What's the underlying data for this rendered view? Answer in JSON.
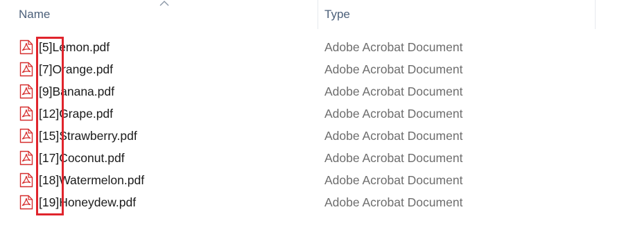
{
  "header": {
    "name_label": "Name",
    "type_label": "Type",
    "sort": "ascending"
  },
  "files": [
    {
      "name": "[5]Lemon.pdf",
      "type": "Adobe Acrobat Document",
      "icon": "pdf-file-icon"
    },
    {
      "name": "[7]Orange.pdf",
      "type": "Adobe Acrobat Document",
      "icon": "pdf-file-icon"
    },
    {
      "name": "[9]Banana.pdf",
      "type": "Adobe Acrobat Document",
      "icon": "pdf-file-icon"
    },
    {
      "name": "[12]Grape.pdf",
      "type": "Adobe Acrobat Document",
      "icon": "pdf-file-icon"
    },
    {
      "name": "[15]Strawberry.pdf",
      "type": "Adobe Acrobat Document",
      "icon": "pdf-file-icon"
    },
    {
      "name": "[17]Coconut.pdf",
      "type": "Adobe Acrobat Document",
      "icon": "pdf-file-icon"
    },
    {
      "name": "[18]Watermelon.pdf",
      "type": "Adobe Acrobat Document",
      "icon": "pdf-file-icon"
    },
    {
      "name": "[19]Honeydew.pdf",
      "type": "Adobe Acrobat Document",
      "icon": "pdf-file-icon"
    }
  ],
  "colors": {
    "pdf_icon": "#d62d2d",
    "highlight": "#e0242c",
    "header_text": "#4c607a",
    "type_text": "#6d6d6d"
  }
}
